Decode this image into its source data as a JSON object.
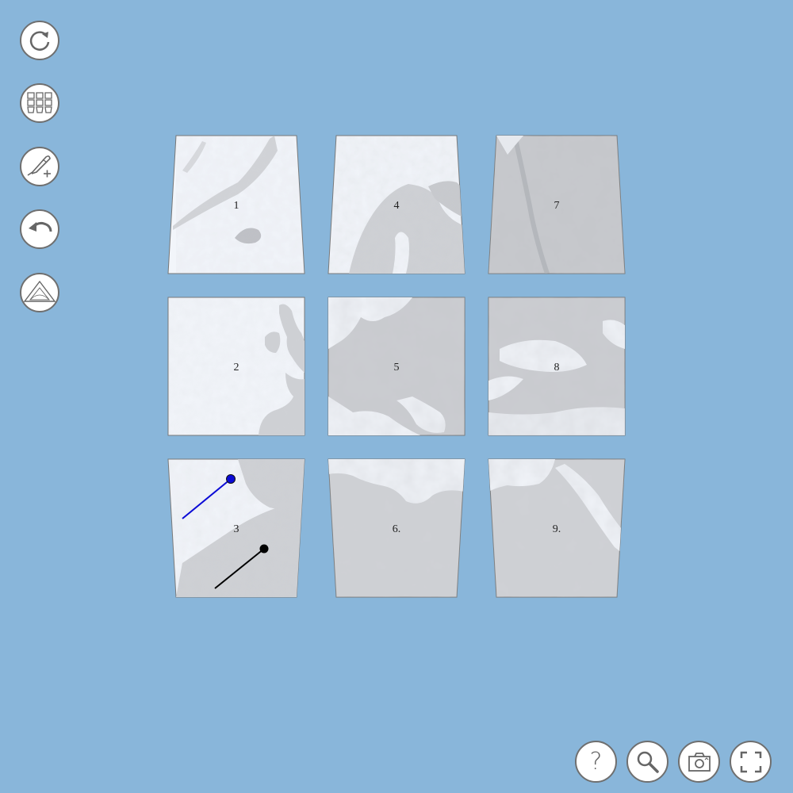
{
  "left_toolbar": {
    "buttons": [
      {
        "id": "rotate",
        "icon": "rotate-clockwise-icon"
      },
      {
        "id": "grid",
        "icon": "grid-tiles-icon"
      },
      {
        "id": "pen",
        "icon": "pen-add-icon"
      },
      {
        "id": "undo",
        "icon": "undo-icon"
      },
      {
        "id": "triangle",
        "icon": "triangle-ruler-icon"
      }
    ]
  },
  "bottom_toolbar": {
    "buttons": [
      {
        "id": "help",
        "icon": "question-mark-icon",
        "label": "?"
      },
      {
        "id": "zoom",
        "icon": "magnifier-icon"
      },
      {
        "id": "camera",
        "icon": "camera-icon"
      },
      {
        "id": "fullscreen",
        "icon": "fullscreen-icon"
      }
    ]
  },
  "tiles": [
    {
      "label": "1",
      "terrain": "ocean-greenland-svalbard"
    },
    {
      "label": "4",
      "terrain": "scandinavia"
    },
    {
      "label": "7",
      "terrain": "russia-urals"
    },
    {
      "label": "2",
      "terrain": "atlantic-british-isles"
    },
    {
      "label": "5",
      "terrain": "central-europe"
    },
    {
      "label": "8",
      "terrain": "black-sea-caucasus"
    },
    {
      "label": "3",
      "terrain": "iberia-northwest-africa"
    },
    {
      "label": "6.",
      "terrain": "sahara-mediterranean"
    },
    {
      "label": "9.",
      "terrain": "egypt-red-sea"
    }
  ],
  "colors": {
    "background": "#89b6da",
    "land": "#c9cbcf",
    "water": "#f2f5fa",
    "button_fill": "#ffffff",
    "button_border": "#6f6f6f",
    "blue_pin": "#0a0ad6",
    "black_pin": "#000000"
  }
}
